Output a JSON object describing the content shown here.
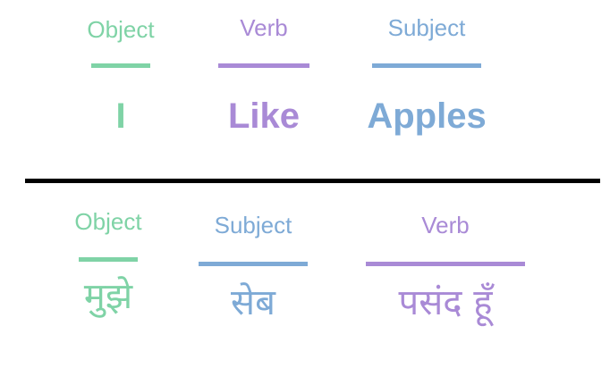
{
  "colors": {
    "object": "#7fd3a6",
    "verb": "#a98ad6",
    "subject": "#7eaad6",
    "divider": "#000000"
  },
  "english": {
    "object_label": "Object",
    "object_word": "I",
    "verb_label": "Verb",
    "verb_word": "Like",
    "subject_label": "Subject",
    "subject_word": "Apples"
  },
  "hindi": {
    "object_label": "Object",
    "object_word": "मुझे",
    "subject_label": "Subject",
    "subject_word": "सेब",
    "verb_label": "Verb",
    "verb_word": "पसंद हूँ"
  }
}
